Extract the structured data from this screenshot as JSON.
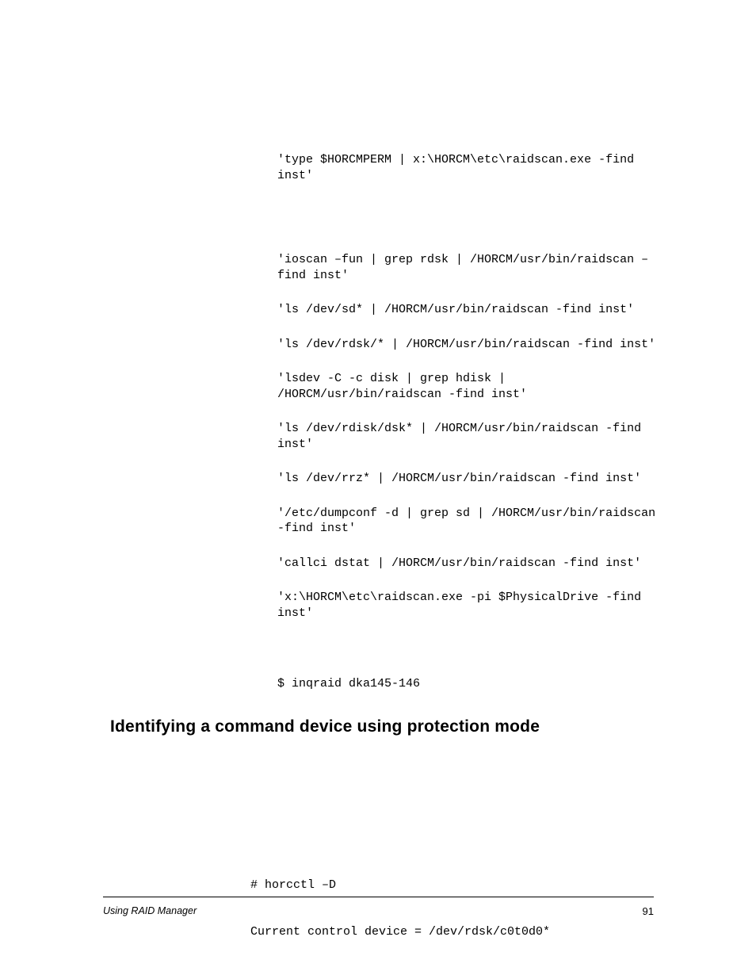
{
  "code": {
    "lines": [
      "'type $HORCMPERM | x:\\HORCM\\etc\\raidscan.exe -find inst'",
      "'ioscan –fun | grep rdsk | /HORCM/usr/bin/raidscan –find inst'",
      "'ls /dev/sd* | /HORCM/usr/bin/raidscan -find inst'",
      "'ls /dev/rdsk/* | /HORCM/usr/bin/raidscan -find inst'",
      "'lsdev -C -c disk | grep hdisk | /HORCM/usr/bin/raidscan -find inst'",
      "'ls /dev/rdisk/dsk* | /HORCM/usr/bin/raidscan -find inst'",
      "'ls /dev/rrz* | /HORCM/usr/bin/raidscan -find inst'",
      "'/etc/dumpconf -d | grep sd | /HORCM/usr/bin/raidscan -find inst'",
      "'callci dstat | /HORCM/usr/bin/raidscan -find inst'",
      "'x:\\HORCM\\etc\\raidscan.exe -pi $PhysicalDrive -find inst'"
    ],
    "standalone": "$ inqraid dka145-146"
  },
  "heading": "Identifying a command device using protection mode",
  "example": {
    "line1": "# horcctl –D",
    "line2": "Current control device = /dev/rdsk/c0t0d0*"
  },
  "footer": {
    "left": "Using RAID Manager",
    "right": "91"
  }
}
